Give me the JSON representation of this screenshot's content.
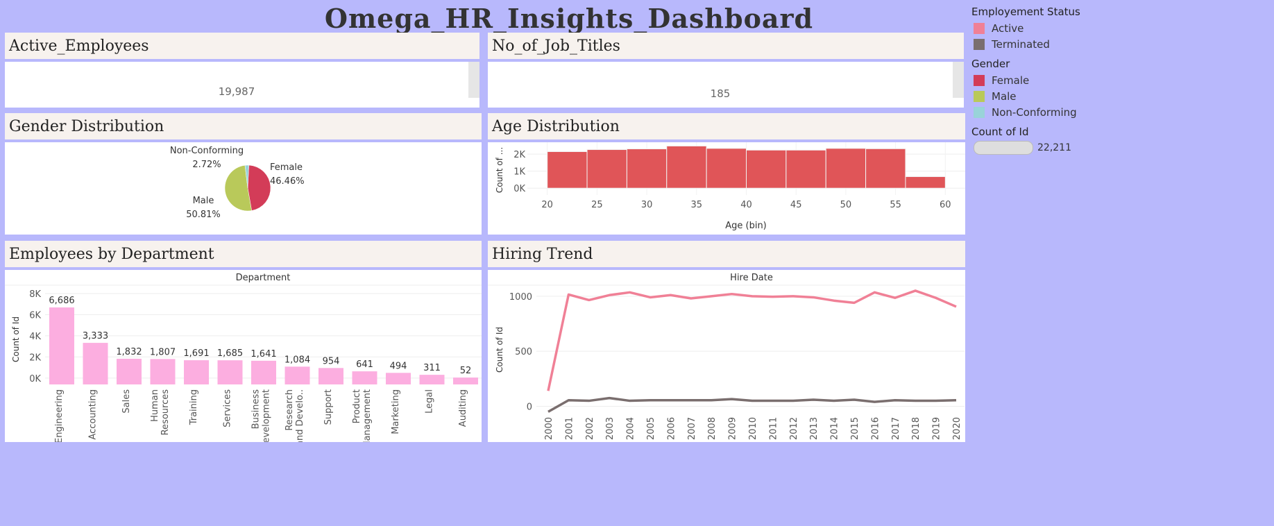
{
  "title": "Omega_HR_Insights_Dashboard",
  "kpis": {
    "active_employees": {
      "label": "Active_Employees",
      "value": "19,987"
    },
    "job_titles": {
      "label": "No_of_Job_Titles",
      "value": "185"
    }
  },
  "legends": {
    "status": {
      "title": "Employement Status",
      "items": [
        {
          "label": "Active",
          "color": "#f08096"
        },
        {
          "label": "Terminated",
          "color": "#7a6e6e"
        }
      ]
    },
    "gender": {
      "title": "Gender",
      "items": [
        {
          "label": "Female",
          "color": "#d33c58"
        },
        {
          "label": "Male",
          "color": "#b9c95a"
        },
        {
          "label": "Non-Conforming",
          "color": "#99d3d9"
        }
      ]
    },
    "count": {
      "title": "Count of Id",
      "value": "22,211"
    }
  },
  "panels": {
    "gender": "Gender Distribution",
    "age": "Age Distribution",
    "department": "Employees by Department",
    "hiring": "Hiring Trend"
  },
  "chart_data": [
    {
      "type": "pie",
      "title": "Gender Distribution",
      "slices": [
        {
          "label": "Female",
          "value": 46.46,
          "display": "46.46%",
          "color": "#d33c58"
        },
        {
          "label": "Male",
          "value": 50.81,
          "display": "50.81%",
          "color": "#b9c95a"
        },
        {
          "label": "Non-Conforming",
          "value": 2.72,
          "display": "2.72%",
          "color": "#99d3d9"
        }
      ]
    },
    {
      "type": "bar",
      "title": "Age Distribution",
      "xlabel": "Age (bin)",
      "ylabel": "Count of ...",
      "bin_starts": [
        20,
        24,
        28,
        32,
        36,
        40,
        44,
        48,
        52,
        56
      ],
      "values": [
        2150,
        2270,
        2310,
        2480,
        2340,
        2240,
        2240,
        2340,
        2320,
        680
      ],
      "xticks": [
        20,
        25,
        30,
        35,
        40,
        45,
        50,
        55,
        60
      ],
      "yticks": [
        {
          "v": 0,
          "label": "0K"
        },
        {
          "v": 1000,
          "label": "1K"
        },
        {
          "v": 2000,
          "label": "2K"
        }
      ],
      "xlim": [
        18,
        62
      ],
      "ylim": [
        -400,
        2700
      ],
      "color": "#e05558"
    },
    {
      "type": "bar",
      "title": "Employees by Department",
      "header": "Department",
      "ylabel": "Count of Id",
      "categories": [
        "Engineering",
        "Accounting",
        "Sales",
        "Human Resources",
        "Training",
        "Services",
        "Business Development",
        "Research and Develo..",
        "Support",
        "Product Management",
        "Marketing",
        "Legal",
        "Auditing"
      ],
      "values": [
        6686,
        3333,
        1832,
        1807,
        1691,
        1685,
        1641,
        1084,
        954,
        641,
        494,
        311,
        52
      ],
      "value_labels": [
        "6,686",
        "3,333",
        "1,832",
        "1,807",
        "1,691",
        "1,685",
        "1,641",
        "1,084",
        "954",
        "641",
        "494",
        "311",
        "52"
      ],
      "yticks": [
        {
          "v": 0,
          "label": "0K"
        },
        {
          "v": 2000,
          "label": "2K"
        },
        {
          "v": 4000,
          "label": "4K"
        },
        {
          "v": 6000,
          "label": "6K"
        },
        {
          "v": 8000,
          "label": "8K"
        }
      ],
      "ylim": [
        -600,
        8000
      ],
      "color": "#fcaee0"
    },
    {
      "type": "line",
      "title": "Hiring Trend",
      "header": "Hire Date",
      "ylabel": "Count of Id",
      "x": [
        2000,
        2001,
        2002,
        2003,
        2004,
        2005,
        2006,
        2007,
        2008,
        2009,
        2010,
        2011,
        2012,
        2013,
        2014,
        2015,
        2016,
        2017,
        2018,
        2019,
        2020
      ],
      "series": [
        {
          "name": "Active",
          "color": "#f08096",
          "values": [
            140,
            1015,
            965,
            1010,
            1035,
            990,
            1010,
            980,
            1000,
            1020,
            1000,
            995,
            1000,
            990,
            960,
            940,
            1035,
            985,
            1050,
            985,
            905
          ]
        },
        {
          "name": "Terminated",
          "color": "#7a6e6e",
          "values": [
            -50,
            55,
            50,
            75,
            50,
            55,
            55,
            55,
            55,
            65,
            50,
            50,
            50,
            60,
            50,
            60,
            40,
            55,
            50,
            50,
            55
          ]
        }
      ],
      "yticks": [
        0,
        500,
        1000
      ],
      "ylim": [
        -60,
        1100
      ]
    }
  ]
}
